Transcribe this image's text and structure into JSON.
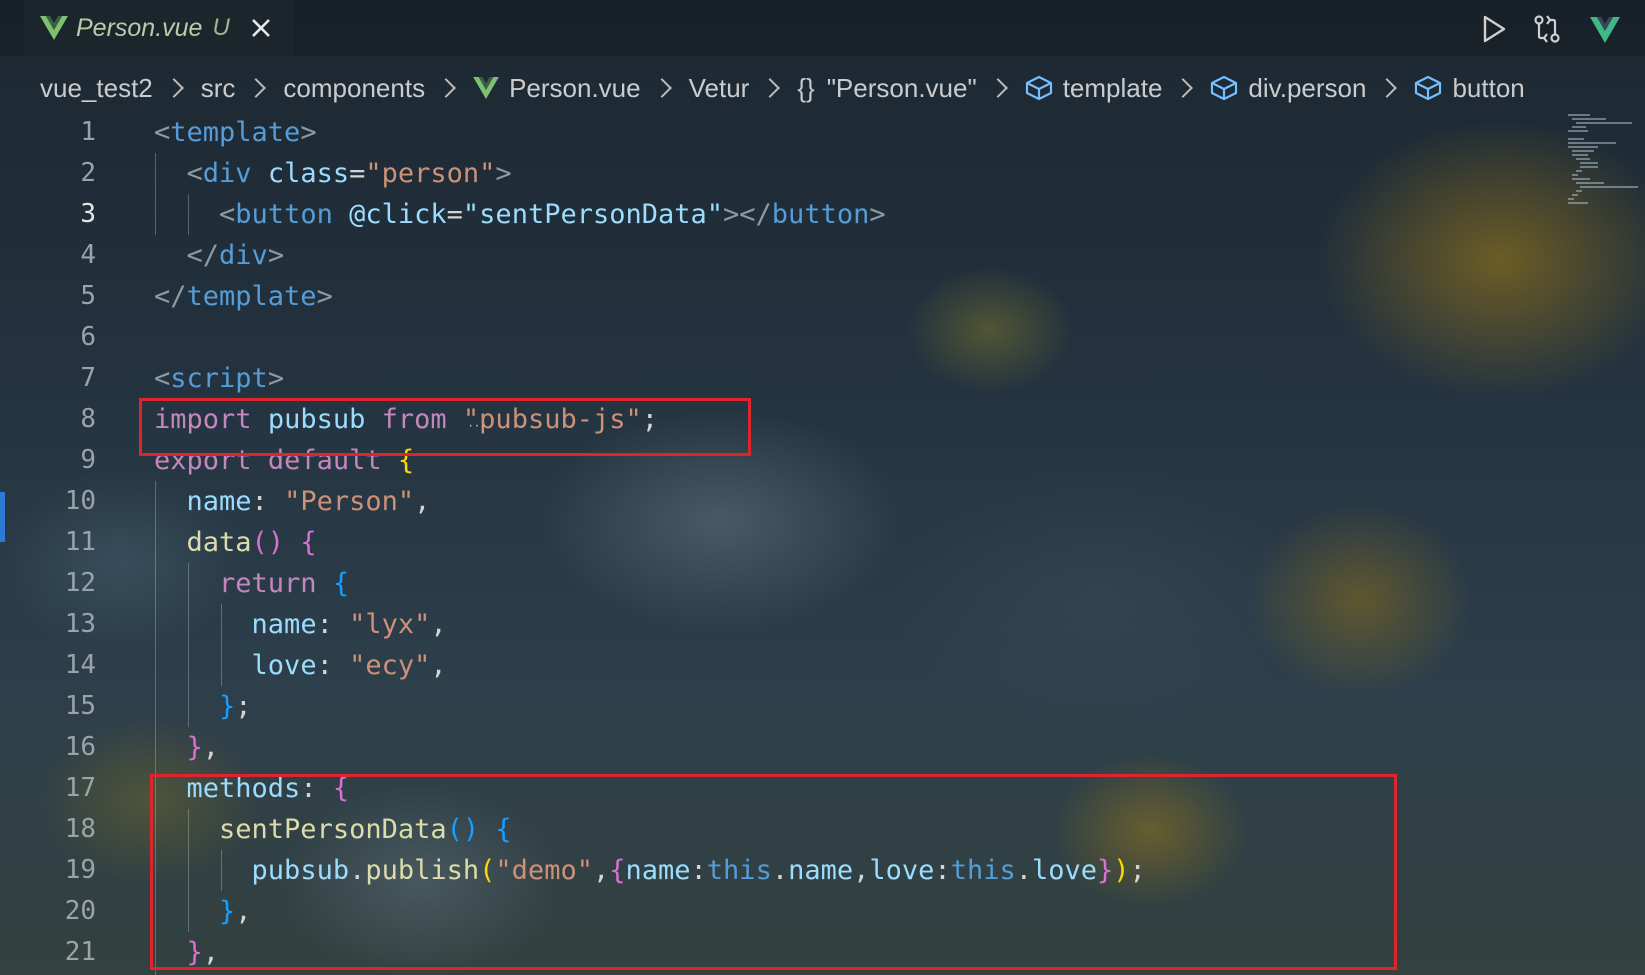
{
  "tab": {
    "filename": "Person.vue",
    "status": "U"
  },
  "toolbar": {
    "run_icon": "play-icon",
    "compare_icon": "git-compare-icon",
    "vue_icon": "vue-icon"
  },
  "breadcrumb": {
    "items": [
      "vue_test2",
      "src",
      "components",
      "Person.vue",
      "Vetur",
      "\"Person.vue\"",
      "template",
      "div.person",
      "button"
    ],
    "braces_glyph": "{}"
  },
  "editor": {
    "active_line": 3,
    "lines": [
      {
        "n": "1"
      },
      {
        "n": "2"
      },
      {
        "n": "3"
      },
      {
        "n": "4"
      },
      {
        "n": "5"
      },
      {
        "n": "6"
      },
      {
        "n": "7"
      },
      {
        "n": "8"
      },
      {
        "n": "9"
      },
      {
        "n": "10"
      },
      {
        "n": "11"
      },
      {
        "n": "12"
      },
      {
        "n": "13"
      },
      {
        "n": "14"
      },
      {
        "n": "15"
      },
      {
        "n": "16"
      },
      {
        "n": "17"
      },
      {
        "n": "18"
      },
      {
        "n": "19"
      },
      {
        "n": "20"
      },
      {
        "n": "21"
      }
    ],
    "code": {
      "l1": [
        "<",
        "template",
        ">"
      ],
      "l2": [
        "<",
        "div",
        "class",
        "=",
        "\"person\"",
        ">"
      ],
      "l3": [
        "<",
        "button",
        "@click",
        "=",
        "\"sentPersonData\"",
        "></",
        "button",
        ">"
      ],
      "l4": [
        "</",
        "div",
        ">"
      ],
      "l5": [
        "</",
        "template",
        ">"
      ],
      "l7": [
        "<",
        "script",
        ">"
      ],
      "l8": [
        "import",
        "pubsub",
        "from",
        "\"pubsub-js\"",
        ";"
      ],
      "l9": [
        "export",
        "default",
        "{"
      ],
      "l10": [
        "name",
        ": ",
        "\"Person\"",
        ","
      ],
      "l11": [
        "data",
        "()",
        " {"
      ],
      "l12": [
        "return",
        "{"
      ],
      "l13": [
        "name",
        ": ",
        "\"lyx\"",
        ","
      ],
      "l14": [
        "love",
        ": ",
        "\"ecy\"",
        ","
      ],
      "l15": [
        "}",
        ";"
      ],
      "l16": [
        "}",
        ","
      ],
      "l17": [
        "methods",
        ": ",
        "{"
      ],
      "l18": [
        "sentPersonData",
        "()",
        " {"
      ],
      "l19": [
        "pubsub",
        ".",
        "publish",
        "(",
        "\"demo\"",
        ",",
        "{",
        "name",
        ":",
        "this",
        ".",
        "name",
        ",",
        "love",
        ":",
        "this",
        ".",
        "love",
        "}",
        ")",
        ";"
      ],
      "l20": [
        "}",
        ","
      ],
      "l21": [
        "}",
        ","
      ]
    }
  },
  "colors": {
    "highlight_box": "#e0242b",
    "tab_text": "#b5cea8",
    "vue_green": "#41b883"
  }
}
